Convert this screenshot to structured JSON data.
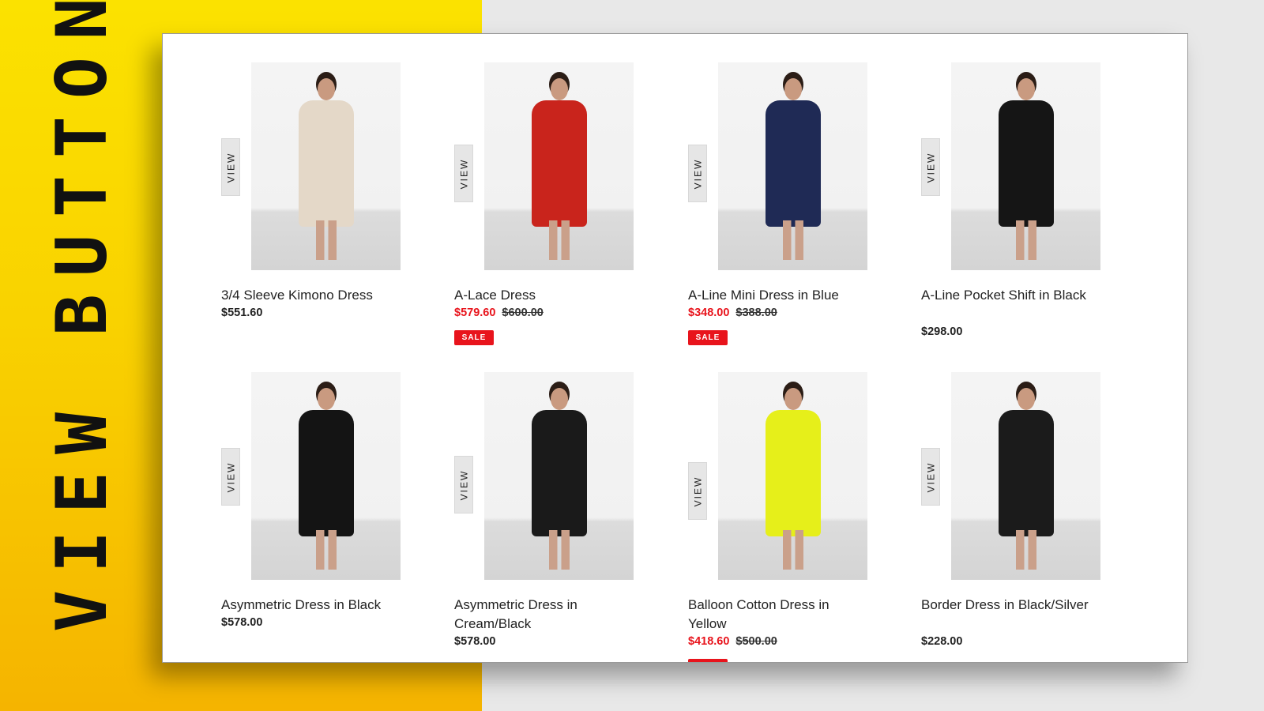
{
  "headline": "VIEW BUTTON",
  "view_label": "VIEW",
  "sale_badge": "SALE",
  "colors": {
    "accent": "#e8141c",
    "background_panel": "#fbd800"
  },
  "products": [
    {
      "title": "3/4 Sleeve Kimono Dress",
      "price": "$551.60",
      "dress": "#e4d8c8"
    },
    {
      "title": "A-Lace Dress",
      "price": "$579.60",
      "old_price": "$600.00",
      "on_sale": true,
      "dress": "#c9241c"
    },
    {
      "title": "A-Line Mini Dress in Blue",
      "price": "$348.00",
      "old_price": "$388.00",
      "on_sale": true,
      "dress": "#1f2a55"
    },
    {
      "title": "A-Line Pocket Shift in Black",
      "price": "$298.00",
      "dress": "#151515"
    },
    {
      "title": "Asymmetric Dress in Black",
      "price": "$578.00",
      "dress": "#141414"
    },
    {
      "title": "Asymmetric Dress in Cream/Black",
      "price": "$578.00",
      "dress": "#1a1a1a"
    },
    {
      "title": "Balloon Cotton Dress in Yellow",
      "price": "$418.60",
      "old_price": "$500.00",
      "on_sale": true,
      "dress": "#e6ef1a"
    },
    {
      "title": "Border Dress in Black/Silver",
      "price": "$228.00",
      "dress": "#1b1b1b"
    }
  ]
}
